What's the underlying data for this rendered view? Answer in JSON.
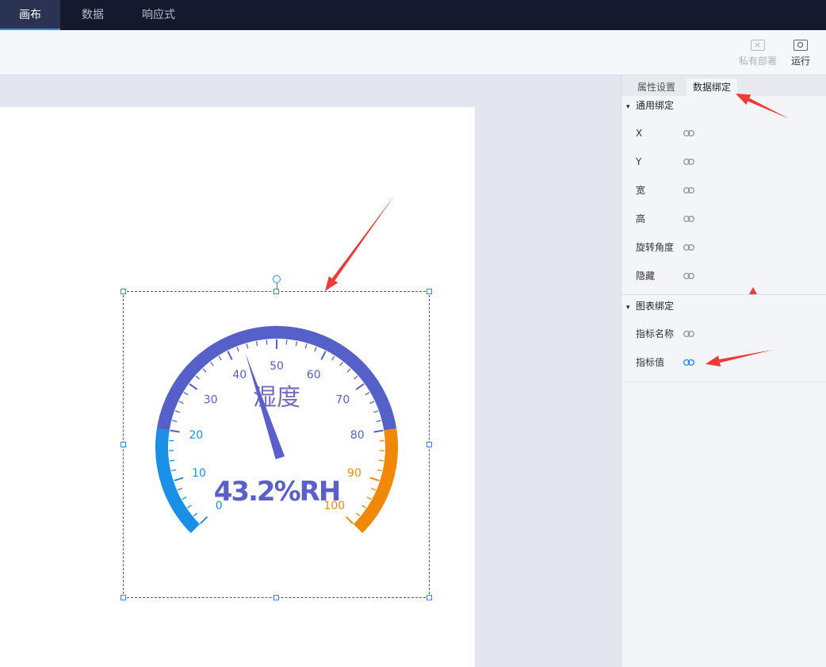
{
  "topbar": {
    "tabs": [
      {
        "label": "画布",
        "active": true
      },
      {
        "label": "数据",
        "active": false
      },
      {
        "label": "响应式",
        "active": false
      }
    ]
  },
  "toolbar": {
    "private_deploy_label": "私有部署",
    "run_label": "运行"
  },
  "gauge": {
    "title": "湿度",
    "value": 43.2,
    "value_text": "43.2%RH",
    "min": 0,
    "max": 100,
    "ticks": [
      "0",
      "10",
      "20",
      "30",
      "40",
      "50",
      "60",
      "70",
      "80",
      "90",
      "100"
    ],
    "colors": {
      "low": "#1a8fe6",
      "mid": "#5560c8",
      "high": "#f0890a",
      "pointer": "#5a5fc9",
      "title": "#7a6abf"
    }
  },
  "panel": {
    "tabs": [
      {
        "label": "属性设置",
        "active": false
      },
      {
        "label": "数据绑定",
        "active": true
      }
    ],
    "general_section": {
      "title": "通用绑定",
      "items": [
        "X",
        "Y",
        "宽",
        "高",
        "旋转角度",
        "隐藏"
      ]
    },
    "chart_section": {
      "title": "图表绑定",
      "items": [
        "指标名称",
        "指标值"
      ]
    }
  },
  "annotation_color": "#ee3b36"
}
